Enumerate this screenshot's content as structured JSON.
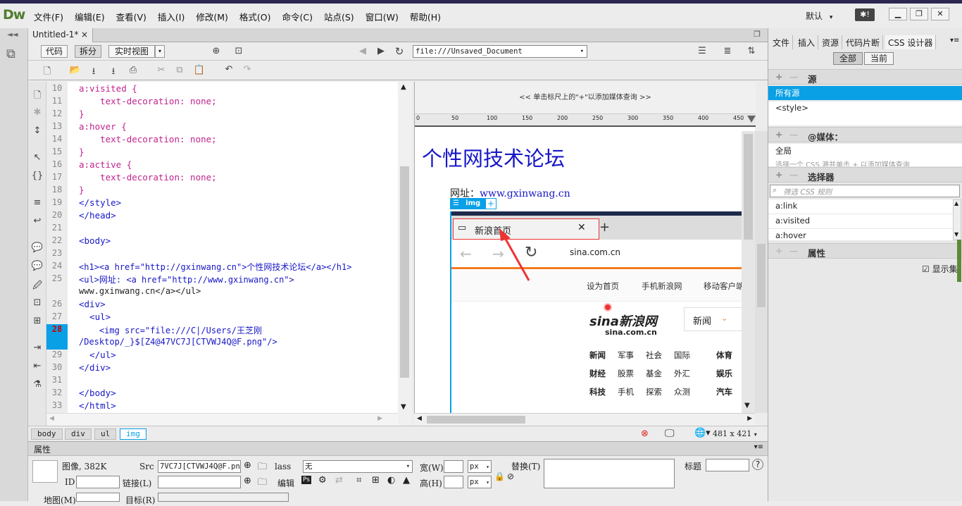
{
  "app": {
    "logo": "Dw",
    "workspace": "默认",
    "workspace_caret": "▾"
  },
  "menus": [
    "文件(F)",
    "编辑(E)",
    "查看(V)",
    "插入(I)",
    "修改(M)",
    "格式(O)",
    "命令(C)",
    "站点(S)",
    "窗口(W)",
    "帮助(H)"
  ],
  "doc_tab": {
    "title": "Untitled-1*",
    "close": "×"
  },
  "view_buttons": {
    "code": "代码",
    "split": "拆分",
    "live": "实时视图"
  },
  "url": {
    "value": "file:///Unsaved_Document"
  },
  "code_lines": [
    {
      "n": "10",
      "text": "a:visited {"
    },
    {
      "n": "11",
      "text": "    text-decoration: none;"
    },
    {
      "n": "12",
      "text": "}"
    },
    {
      "n": "13",
      "text": "a:hover {"
    },
    {
      "n": "14",
      "text": "    text-decoration: none;"
    },
    {
      "n": "15",
      "text": "}"
    },
    {
      "n": "16",
      "text": "a:active {"
    },
    {
      "n": "17",
      "text": "    text-decoration: none;"
    },
    {
      "n": "18",
      "text": "}"
    },
    {
      "n": "19",
      "text": "</style>"
    },
    {
      "n": "20",
      "text": "</head>"
    },
    {
      "n": "21",
      "text": ""
    },
    {
      "n": "22",
      "text": "<body>"
    },
    {
      "n": "23",
      "text": ""
    },
    {
      "n": "24",
      "text": "<h1><a href=\"http://gxinwang.cn\">个性网技术论坛</a></h1>"
    },
    {
      "n": "25",
      "text": "<ul>网址: <a href=\"http://www.gxinwang.cn\">"
    },
    {
      "n": "",
      "text": "www.gxinwang.cn</a></ul>"
    },
    {
      "n": "26",
      "text": "<div>"
    },
    {
      "n": "27",
      "text": "  <ul>"
    },
    {
      "n": "28",
      "text": "    <img src=\"file:///C|/Users/王芝刚"
    },
    {
      "n": "",
      "text": "/Desktop/_}$[Z4@47VC7J[CTVWJ4Q@F.png\"/>"
    },
    {
      "n": "29",
      "text": "  </ul>"
    },
    {
      "n": "30",
      "text": "</div>"
    },
    {
      "n": "31",
      "text": ""
    },
    {
      "n": "32",
      "text": "</body>"
    },
    {
      "n": "33",
      "text": "</html>"
    }
  ],
  "active_line": "28",
  "design": {
    "media_query_hint": "<< 单击标尺上的\"+\"以添加媒体查询 >>",
    "ruler_ticks": [
      "0",
      "50",
      "100",
      "150",
      "200",
      "250",
      "300",
      "350",
      "400",
      "450"
    ],
    "heading": "个性网技术论坛",
    "url_label": "网址：",
    "url_link": "www.gxinwang.cn",
    "img_tag": "img",
    "img_plus": "+",
    "browser": {
      "tab_title": "新浪首页",
      "address": "sina.com.cn",
      "toolbar_links": [
        "设为首页",
        "手机新浪网",
        "移动客户端"
      ],
      "logo_text": "sina新浪网",
      "logo_sub": "sina.com.cn",
      "search_category": "新闻",
      "nav_rows": [
        [
          "新闻",
          "军事",
          "社会",
          "国际",
          "体育"
        ],
        [
          "财经",
          "股票",
          "基金",
          "外汇",
          "娱乐"
        ],
        [
          "科技",
          "手机",
          "探索",
          "众测",
          "汽车"
        ]
      ]
    }
  },
  "right_panel": {
    "tabs": [
      "文件",
      "插入",
      "资源",
      "代码片断",
      "CSS 设计器"
    ],
    "filter_buttons": {
      "all": "全部",
      "current": "当前"
    },
    "sources_header": "源",
    "sources": [
      "所有源",
      "<style>"
    ],
    "media_header": "@媒体：",
    "media_items": [
      "全局"
    ],
    "media_hint": "选择一个 CSS 源并单击 + 以添加媒体查询",
    "selectors_header": "选择器",
    "selector_filter_placeholder": "筛选 CSS 规则",
    "selectors": [
      "a:link",
      "a:visited",
      "a:hover"
    ],
    "properties_header": "属性",
    "show_set": "显示集"
  },
  "status": {
    "crumbs": [
      "body",
      "div",
      "ul",
      "img"
    ],
    "window_size": "481 x 421"
  },
  "props": {
    "header": "属性",
    "image_info": "图像, 382K",
    "id_label": "ID",
    "src_label": "Src",
    "src_value": "7VC7J[CTVWJ4Q@F.png",
    "link_label": "链接(L)",
    "class_label": "lass",
    "class_value": "无",
    "edit_label": "编辑",
    "width_label": "宽(W)",
    "height_label": "高(H)",
    "unit": "px",
    "alt_label": "替换(T)",
    "title_label": "标题",
    "map_label": "地图(M)",
    "target_label": "目标(R)"
  }
}
